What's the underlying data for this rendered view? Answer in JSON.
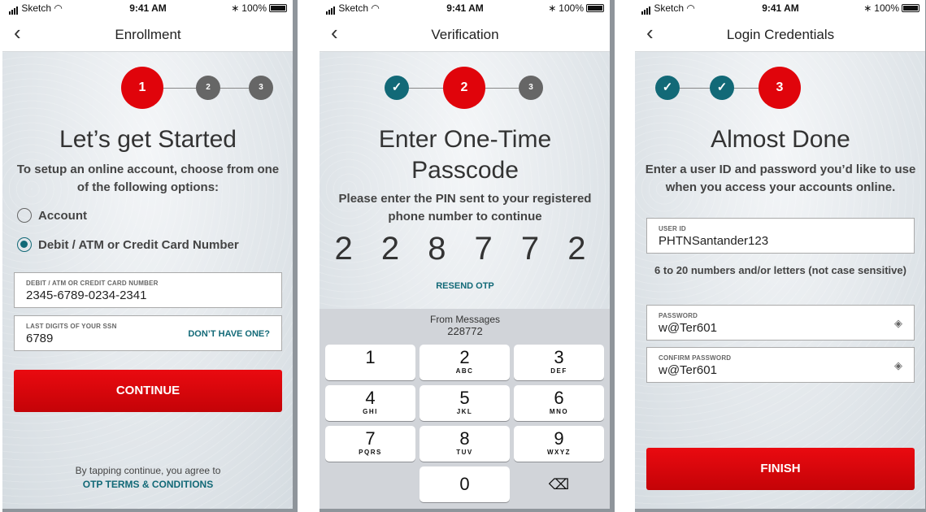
{
  "status": {
    "carrier": "Sketch",
    "time": "9:41 AM",
    "battery": "100%"
  },
  "screens": {
    "enrollment": {
      "title": "Enrollment",
      "steps": [
        "1",
        "2",
        "3"
      ],
      "heading": "Let’s get Started",
      "subtext": "To setup an online account, choose from one of the following options:",
      "options": [
        "Account",
        "Debit / ATM or Credit Card Number"
      ],
      "selected_option": "Debit / ATM or Credit Card Number",
      "card_field": {
        "label": "DEBIT / ATM OR CREDIT CARD NUMBER",
        "value": "2345-6789-0234-2341"
      },
      "ssn_field": {
        "label": "LAST DIGITS OF YOUR SSN",
        "value": "6789",
        "link": "DON’T HAVE ONE?"
      },
      "button": "CONTINUE",
      "footer_text": "By tapping continue, you agree to",
      "footer_link": "OTP TERMS & CONDITIONS"
    },
    "verification": {
      "title": "Verification",
      "steps": [
        "✓",
        "2",
        "3"
      ],
      "heading_line1": "Enter One-Time",
      "heading_line2": "Passcode",
      "subtext": "Please enter the PIN sent to your registered phone number to continue",
      "otp": "228772",
      "resend": "RESEND OTP",
      "suggestion_source": "From Messages",
      "suggestion_code": "228772",
      "keys": [
        {
          "digit": "1",
          "letters": ""
        },
        {
          "digit": "2",
          "letters": "ABC"
        },
        {
          "digit": "3",
          "letters": "DEF"
        },
        {
          "digit": "4",
          "letters": "GHI"
        },
        {
          "digit": "5",
          "letters": "JKL"
        },
        {
          "digit": "6",
          "letters": "MNO"
        },
        {
          "digit": "7",
          "letters": "PQRS"
        },
        {
          "digit": "8",
          "letters": "TUV"
        },
        {
          "digit": "9",
          "letters": "WXYZ"
        },
        {
          "digit": "0",
          "letters": ""
        }
      ]
    },
    "credentials": {
      "title": "Login Credentials",
      "steps": [
        "✓",
        "✓",
        "3"
      ],
      "heading": "Almost Done",
      "subtext": "Enter a user ID and password you’d like to use when you access your accounts online.",
      "user_id": {
        "label": "USER ID",
        "value": "PHTNSantander123"
      },
      "hint": "6 to 20 numbers and/or letters (not case sensitive)",
      "password": {
        "label": "PASSWORD",
        "value": "w@Ter601"
      },
      "confirm_password": {
        "label": "CONFIRM PASSWORD",
        "value": "w@Ter601"
      },
      "button": "FINISH"
    }
  },
  "colors": {
    "brand_red": "#e0040b",
    "teal": "#126977",
    "step_grey": "#666666"
  },
  "icons": {
    "back": "chevron-left-icon",
    "eye": "eye-slash-icon",
    "delete": "backspace-icon",
    "check": "checkmark-icon"
  }
}
